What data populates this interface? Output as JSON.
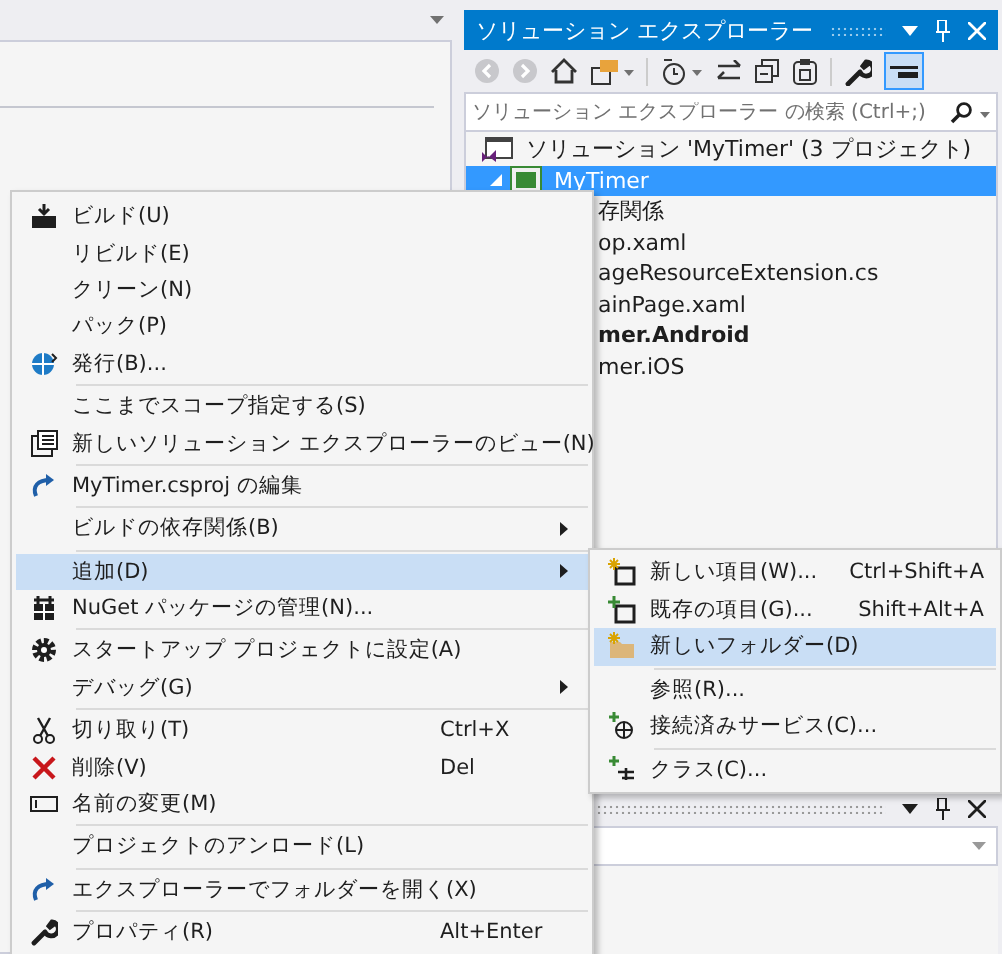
{
  "solution_explorer": {
    "title": "ソリューション エクスプローラー",
    "search": {
      "placeholder": "ソリューション エクスプローラー の検索 (Ctrl+;)"
    },
    "tree": [
      {
        "label": "ソリューション 'MyTimer' (3 プロジェクト)",
        "selected": false,
        "bold": false
      },
      {
        "label": "MyTimer",
        "selected": true,
        "bold": false
      },
      {
        "label": "存関係",
        "selected": false,
        "bold": false
      },
      {
        "label": "op.xaml",
        "selected": false,
        "bold": false
      },
      {
        "label": "ageResourceExtension.cs",
        "selected": false,
        "bold": false
      },
      {
        "label": "ainPage.xaml",
        "selected": false,
        "bold": false
      },
      {
        "label": "mer.Android",
        "selected": false,
        "bold": true
      },
      {
        "label": "mer.iOS",
        "selected": false,
        "bold": false
      }
    ]
  },
  "context_menu": {
    "items": [
      {
        "kind": "item",
        "label": "ビルド(U)",
        "submenu": false,
        "selected": false
      },
      {
        "kind": "item",
        "label": "リビルド(E)",
        "submenu": false,
        "selected": false
      },
      {
        "kind": "item",
        "label": "クリーン(N)",
        "submenu": false,
        "selected": false
      },
      {
        "kind": "item",
        "label": "パック(P)",
        "submenu": false,
        "selected": false
      },
      {
        "kind": "item",
        "label": "発行(B)...",
        "submenu": false,
        "selected": false
      },
      {
        "kind": "separator"
      },
      {
        "kind": "item",
        "label": "ここまでスコープ指定する(S)",
        "submenu": false,
        "selected": false
      },
      {
        "kind": "item",
        "label": "新しいソリューション エクスプローラーのビュー(N)",
        "submenu": false,
        "selected": false
      },
      {
        "kind": "separator"
      },
      {
        "kind": "item",
        "label": "MyTimer.csproj の編集",
        "submenu": false,
        "selected": false
      },
      {
        "kind": "separator"
      },
      {
        "kind": "item",
        "label": "ビルドの依存関係(B)",
        "submenu": true,
        "selected": false
      },
      {
        "kind": "separator"
      },
      {
        "kind": "item",
        "label": "追加(D)",
        "submenu": true,
        "selected": true
      },
      {
        "kind": "item",
        "label": "NuGet パッケージの管理(N)...",
        "submenu": false,
        "selected": false
      },
      {
        "kind": "separator"
      },
      {
        "kind": "item",
        "label": "スタートアップ プロジェクトに設定(A)",
        "submenu": false,
        "selected": false
      },
      {
        "kind": "item",
        "label": "デバッグ(G)",
        "submenu": true,
        "selected": false
      },
      {
        "kind": "separator"
      },
      {
        "kind": "item",
        "label": "切り取り(T)",
        "shortcut": "Ctrl+X",
        "submenu": false,
        "selected": false
      },
      {
        "kind": "item",
        "label": "削除(V)",
        "shortcut": "Del",
        "submenu": false,
        "selected": false
      },
      {
        "kind": "item",
        "label": "名前の変更(M)",
        "submenu": false,
        "selected": false
      },
      {
        "kind": "separator"
      },
      {
        "kind": "item",
        "label": "プロジェクトのアンロード(L)",
        "submenu": false,
        "selected": false
      },
      {
        "kind": "separator"
      },
      {
        "kind": "item",
        "label": "エクスプローラーでフォルダーを開く(X)",
        "submenu": false,
        "selected": false
      },
      {
        "kind": "separator"
      },
      {
        "kind": "item",
        "label": "プロパティ(R)",
        "shortcut": "Alt+Enter",
        "submenu": false,
        "selected": false
      }
    ]
  },
  "add_submenu": {
    "items": [
      {
        "kind": "item",
        "label": "新しい項目(W)...",
        "shortcut": "Ctrl+Shift+A",
        "selected": false
      },
      {
        "kind": "item",
        "label": "既存の項目(G)...",
        "shortcut": "Shift+Alt+A",
        "selected": false
      },
      {
        "kind": "item",
        "label": "新しいフォルダー(D)",
        "selected": true
      },
      {
        "kind": "separator"
      },
      {
        "kind": "item",
        "label": "参照(R)...",
        "selected": false
      },
      {
        "kind": "item",
        "label": "接続済みサービス(C)...",
        "selected": false
      },
      {
        "kind": "separator"
      },
      {
        "kind": "item",
        "label": "クラス(C)...",
        "selected": false
      }
    ]
  }
}
